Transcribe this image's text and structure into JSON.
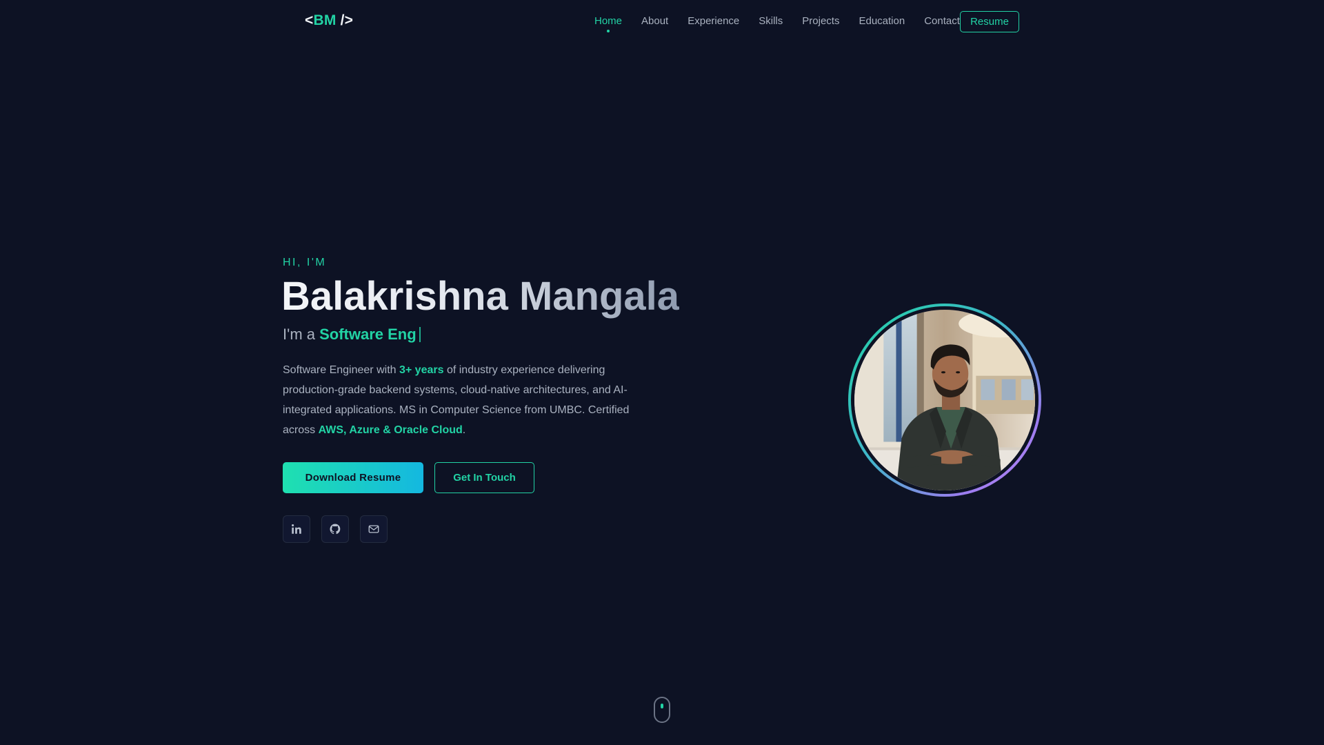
{
  "logo": {
    "open": "<",
    "initials": "BM",
    "close": " />"
  },
  "nav": {
    "items": [
      {
        "label": "Home",
        "active": true
      },
      {
        "label": "About",
        "active": false
      },
      {
        "label": "Experience",
        "active": false
      },
      {
        "label": "Skills",
        "active": false
      },
      {
        "label": "Projects",
        "active": false
      },
      {
        "label": "Education",
        "active": false
      },
      {
        "label": "Contact",
        "active": false
      }
    ],
    "resume_label": "Resume"
  },
  "hero": {
    "greeting": "HI, I'M",
    "name": "Balakrishna Mangala",
    "role_prefix": "I'm a ",
    "role_typed": "Software Eng",
    "description": {
      "part1": "Software Engineer with ",
      "highlight1": "3+ years",
      "part2": " of industry experience delivering production-grade backend systems, cloud-native architectures, and AI-integrated applications. MS in Computer Science from UMBC. Certified across ",
      "highlight2": "AWS, Azure & Oracle Cloud",
      "part3": "."
    },
    "download_label": "Download Resume",
    "touch_label": "Get In Touch"
  },
  "socials": [
    {
      "icon": "linkedin-icon"
    },
    {
      "icon": "github-icon"
    },
    {
      "icon": "mail-icon"
    }
  ],
  "colors": {
    "background": "#0d1224",
    "accent": "#22d3a5",
    "accent_secondary": "#14b8e0",
    "ring_end": "#c08cf5",
    "text_muted": "#aab2c0"
  }
}
